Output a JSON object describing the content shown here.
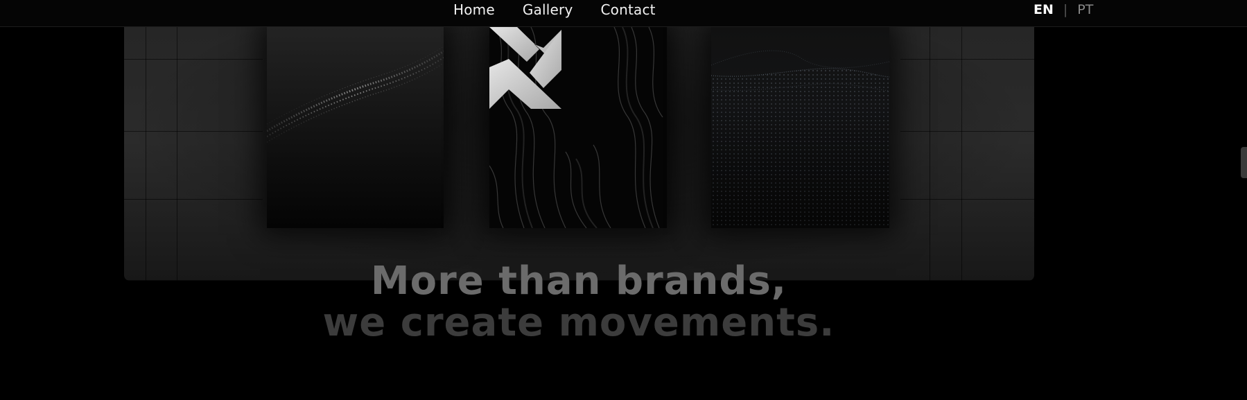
{
  "nav": {
    "links": [
      "Home",
      "Gallery",
      "Contact"
    ]
  },
  "language": {
    "active": "EN",
    "separator": "|",
    "alternate": "PT"
  },
  "hero": {
    "headline_line1": "More than brands,",
    "headline_line2": "we create movements."
  },
  "colors": {
    "background": "#000000",
    "headline_primary": "#6b6b6b",
    "headline_secondary": "#3c3c3c",
    "logo": "#cfcfcf"
  },
  "icons": {
    "brand_logo": "x-chevron-logo"
  }
}
